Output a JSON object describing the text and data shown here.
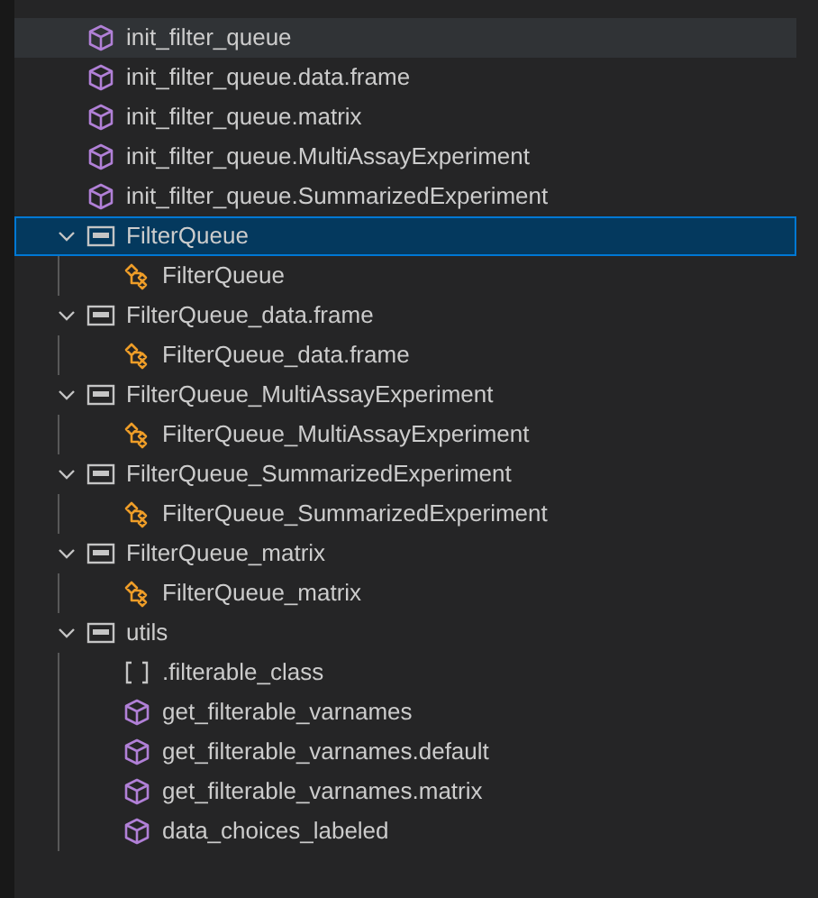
{
  "outline": {
    "items": [
      {
        "label": "init_filter_queue",
        "kind": "module",
        "selected": false,
        "hovered": true
      },
      {
        "label": "init_filter_queue.data.frame",
        "kind": "module",
        "selected": false
      },
      {
        "label": "init_filter_queue.matrix",
        "kind": "module",
        "selected": false
      },
      {
        "label": "init_filter_queue.MultiAssayExperiment",
        "kind": "module",
        "selected": false
      },
      {
        "label": "init_filter_queue.SummarizedExperiment",
        "kind": "module",
        "selected": false
      },
      {
        "label": "FilterQueue",
        "kind": "string",
        "selected": true,
        "expanded": true,
        "children": [
          {
            "label": "FilterQueue",
            "kind": "class",
            "selected": false
          }
        ]
      },
      {
        "label": "FilterQueue_data.frame",
        "kind": "string",
        "selected": false,
        "expanded": true,
        "children": [
          {
            "label": "FilterQueue_data.frame",
            "kind": "class",
            "selected": false
          }
        ]
      },
      {
        "label": "FilterQueue_MultiAssayExperiment",
        "kind": "string",
        "selected": false,
        "expanded": true,
        "children": [
          {
            "label": "FilterQueue_MultiAssayExperiment",
            "kind": "class",
            "selected": false
          }
        ]
      },
      {
        "label": "FilterQueue_SummarizedExperiment",
        "kind": "string",
        "selected": false,
        "expanded": true,
        "children": [
          {
            "label": "FilterQueue_SummarizedExperiment",
            "kind": "class",
            "selected": false
          }
        ]
      },
      {
        "label": "FilterQueue_matrix",
        "kind": "string",
        "selected": false,
        "expanded": true,
        "children": [
          {
            "label": "FilterQueue_matrix",
            "kind": "class",
            "selected": false
          }
        ]
      },
      {
        "label": "utils",
        "kind": "string",
        "selected": false,
        "expanded": true,
        "children": [
          {
            "label": ".filterable_class",
            "kind": "array",
            "selected": false
          },
          {
            "label": "get_filterable_varnames",
            "kind": "module",
            "selected": false
          },
          {
            "label": "get_filterable_varnames.default",
            "kind": "module",
            "selected": false
          },
          {
            "label": "get_filterable_varnames.matrix",
            "kind": "module",
            "selected": false
          },
          {
            "label": "data_choices_labeled",
            "kind": "module",
            "selected": false
          }
        ]
      }
    ]
  }
}
